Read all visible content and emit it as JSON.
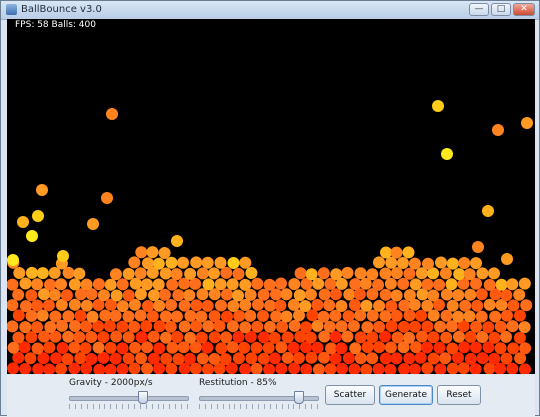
{
  "window": {
    "title": "BallBounce v3.0",
    "controls": {
      "minimize": "—",
      "maximize": "□",
      "close": "✕"
    }
  },
  "hud": {
    "text": "FPS: 58 Balls: 400"
  },
  "sliders": {
    "gravity": {
      "label": "Gravity - 2000px/s",
      "fraction": 0.63
    },
    "restitution": {
      "label": "Restitution - 85%",
      "fraction": 0.85
    }
  },
  "buttons": {
    "scatter": "Scatter",
    "generate": "Generate",
    "reset": "Reset"
  },
  "colors": {
    "ball_palette": [
      "#ff2a00",
      "#ff4400",
      "#ff5a10",
      "#ff6e1a",
      "#ff8420",
      "#ff9a22",
      "#ffb11e",
      "#ffcc18",
      "#ffe81e"
    ],
    "canvas_background": "#000000"
  }
}
